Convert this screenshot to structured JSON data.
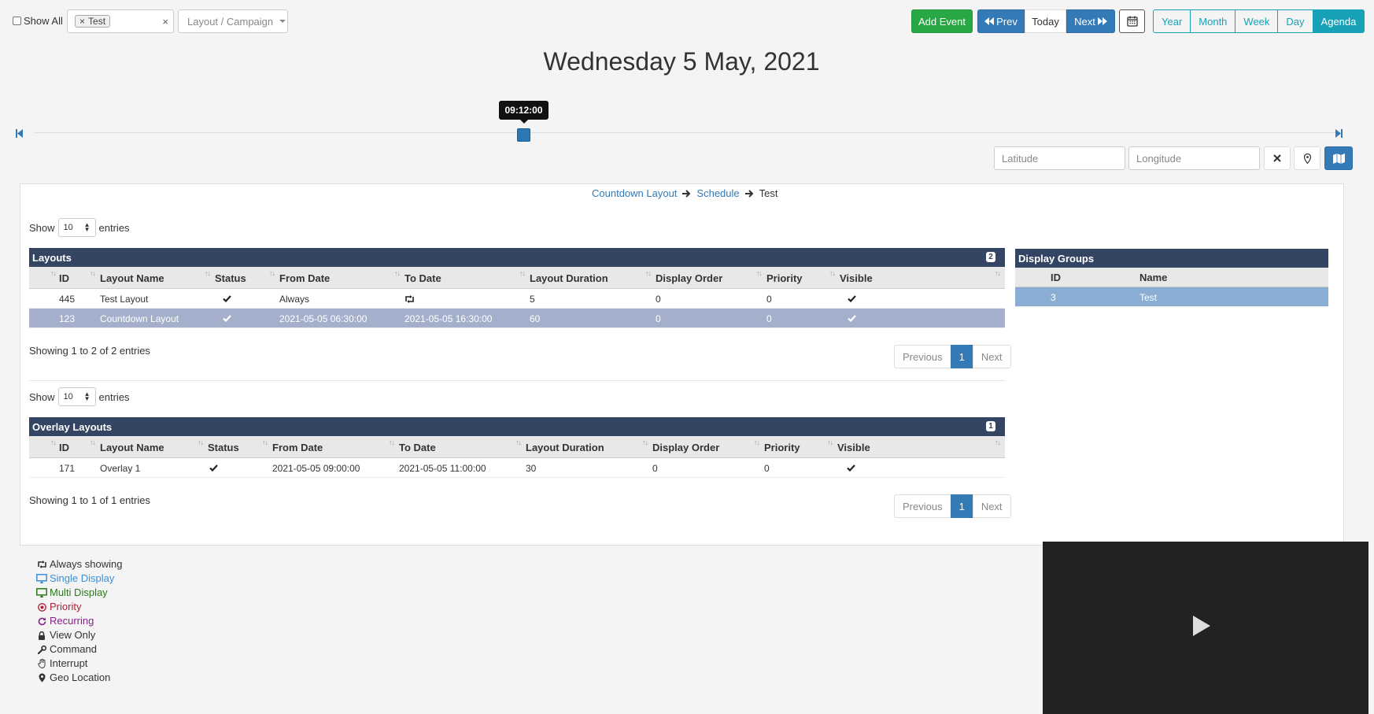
{
  "toolbar": {
    "show_all": "Show All",
    "tag": "Test",
    "tag_remove": "×",
    "clear": "×",
    "layout_campaign": "Layout / Campaign",
    "add_event": "Add Event",
    "prev": "Prev",
    "today": "Today",
    "next": "Next",
    "views": [
      "Year",
      "Month",
      "Week",
      "Day",
      "Agenda"
    ],
    "active_view": "Agenda"
  },
  "title": "Wednesday 5 May, 2021",
  "timeline": {
    "time": "09:12:00",
    "position_fraction": 0.375
  },
  "geo": {
    "latitude_placeholder": "Latitude",
    "longitude_placeholder": "Longitude"
  },
  "breadcrumb": [
    "Countdown Layout",
    "Schedule",
    "Test"
  ],
  "layouts": {
    "show": "Show",
    "length": "10",
    "entries": "entries",
    "title": "Layouts",
    "count": "2",
    "columns": [
      "ID",
      "Layout Name",
      "Status",
      "From Date",
      "To Date",
      "Layout Duration",
      "Display Order",
      "Priority",
      "Visible"
    ],
    "rows": [
      {
        "id": "445",
        "name": "Test Layout",
        "status": "check",
        "from": "Always",
        "to": "repeat",
        "duration": "5",
        "order": "0",
        "priority": "0",
        "visible": "check",
        "selected": false
      },
      {
        "id": "123",
        "name": "Countdown Layout",
        "status": "check",
        "from": "2021-05-05 06:30:00",
        "to": "2021-05-05 16:30:00",
        "duration": "60",
        "order": "0",
        "priority": "0",
        "visible": "check",
        "selected": true
      }
    ],
    "info": "Showing 1 to 2 of 2 entries",
    "pager": {
      "previous": "Previous",
      "page": "1",
      "next": "Next"
    }
  },
  "overlays": {
    "show": "Show",
    "length": "10",
    "entries": "entries",
    "title": "Overlay Layouts",
    "count": "1",
    "columns": [
      "ID",
      "Layout Name",
      "Status",
      "From Date",
      "To Date",
      "Layout Duration",
      "Display Order",
      "Priority",
      "Visible"
    ],
    "rows": [
      {
        "id": "171",
        "name": "Overlay 1",
        "status": "check",
        "from": "2021-05-05 09:00:00",
        "to": "2021-05-05 11:00:00",
        "duration": "30",
        "order": "0",
        "priority": "0",
        "visible": "check"
      }
    ],
    "info": "Showing 1 to 1 of 1 entries",
    "pager": {
      "previous": "Previous",
      "page": "1",
      "next": "Next"
    }
  },
  "display_groups": {
    "title": "Display Groups",
    "columns": [
      "ID",
      "Name"
    ],
    "rows": [
      {
        "id": "3",
        "name": "Test"
      }
    ]
  },
  "legend": [
    {
      "icon": "retweet-icon",
      "label": "Always showing",
      "color": "#333333"
    },
    {
      "icon": "desktop-icon",
      "label": "Single Display",
      "color": "#3a8fd9"
    },
    {
      "icon": "desktop-icon",
      "label": "Multi Display",
      "color": "#2a7a1a"
    },
    {
      "icon": "bullseye-icon",
      "label": "Priority",
      "color": "#b0203a"
    },
    {
      "icon": "refresh-icon",
      "label": "Recurring",
      "color": "#8a1e8a"
    },
    {
      "icon": "lock-icon",
      "label": "View Only",
      "color": "#333333"
    },
    {
      "icon": "wrench-icon",
      "label": "Command",
      "color": "#333333"
    },
    {
      "icon": "hand-icon",
      "label": "Interrupt",
      "color": "#333333"
    },
    {
      "icon": "map-marker-icon",
      "label": "Geo Location",
      "color": "#333333"
    }
  ],
  "colors": {
    "primary": "#337ab7",
    "success": "#28a745",
    "info": "#17a2b8",
    "table_header": "#344564",
    "selected_row": "#a4b0cb",
    "group_row": "#8aaed3"
  }
}
